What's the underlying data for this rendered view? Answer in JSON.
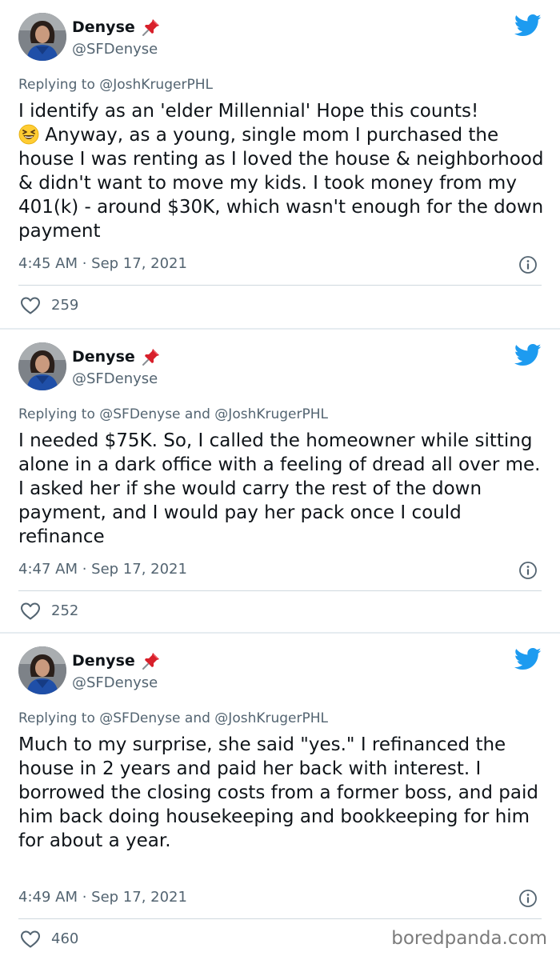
{
  "tweets": [
    {
      "author": "Denyse",
      "handle": "@SFDenyse",
      "replying_to": "Replying to @JoshKrugerPHL",
      "text_before_emoji": "I identify as an 'elder Millennial' Hope this counts!\n",
      "emoji": "grinning-squinting-face",
      "text_after_emoji": " Anyway, as a young, single mom I purchased the house I was renting as I loved the house & neighborhood & didn't want to move my kids. I took money from my 401(k)  - around $30K, which wasn't enough for the down payment",
      "timestamp": "4:45 AM · Sep 17, 2021",
      "likes": "259"
    },
    {
      "author": "Denyse",
      "handle": "@SFDenyse",
      "replying_to": "Replying to @SFDenyse and @JoshKrugerPHL",
      "text": "I needed $75K. So, I called the homeowner while sitting alone in a dark office with a feeling of dread all over me. I asked her if she would carry the rest of the down payment, and I would pay her pack once I could refinance",
      "timestamp": "4:47 AM · Sep 17, 2021",
      "likes": "252"
    },
    {
      "author": "Denyse",
      "handle": "@SFDenyse",
      "replying_to": "Replying to @SFDenyse and @JoshKrugerPHL",
      "text": "Much to my surprise, she said \"yes.\" I refinanced the house in 2 years and paid her back with interest. I borrowed the closing costs from a former boss, and paid him back doing housekeeping and bookkeeping for him for about a year.",
      "timestamp": "4:49 AM · Sep 17, 2021",
      "likes": "460"
    }
  ],
  "watermark": "boredpanda.com",
  "colors": {
    "twitter_blue": "#1d9bf0",
    "secondary_text": "#536471",
    "pin_red": "#d8202b"
  }
}
